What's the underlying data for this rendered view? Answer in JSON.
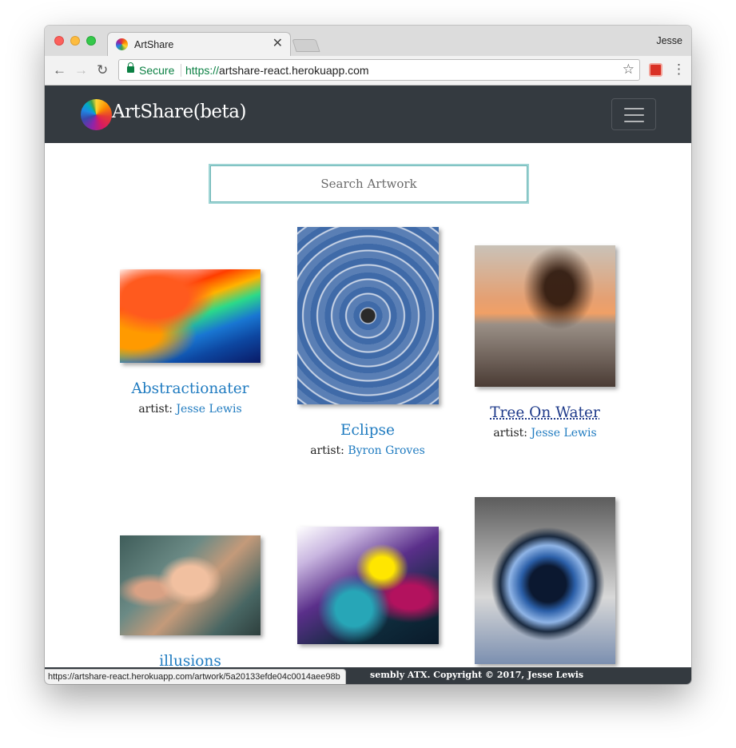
{
  "browser": {
    "tab_title": "ArtShare",
    "tab_close": "✕",
    "profile_name": "Jesse",
    "secure_label": "Secure",
    "url_scheme": "https://",
    "url_host": "artshare-react.herokuapp.com",
    "nav_back": "←",
    "nav_forward": "→",
    "nav_reload": "↻",
    "bookmark_icon": "☆",
    "menu_icon": "⋮"
  },
  "header": {
    "brand": "ArtShare(beta)"
  },
  "search": {
    "placeholder": "Search Artwork"
  },
  "artworks": [
    {
      "title": "Abstractionater",
      "artist_prefix": "artist:",
      "artist": "Jesse Lewis"
    },
    {
      "title": "Eclipse",
      "artist_prefix": "artist:",
      "artist": "Byron Groves"
    },
    {
      "title": "Tree On Water",
      "artist_prefix": "artist:",
      "artist": "Jesse Lewis"
    },
    {
      "title": "illusions"
    },
    {
      "title": ""
    },
    {
      "title": ""
    }
  ],
  "footer": {
    "text": "sembly ATX. Copyright © 2017, Jesse Lewis"
  },
  "status_bar": {
    "url": "https://artshare-react.herokuapp.com/artwork/5a20133efde04c0014aee98b"
  },
  "colors": {
    "navbar_bg": "#343a40",
    "link": "#1f7bc0",
    "secure_green": "#0b8043"
  }
}
